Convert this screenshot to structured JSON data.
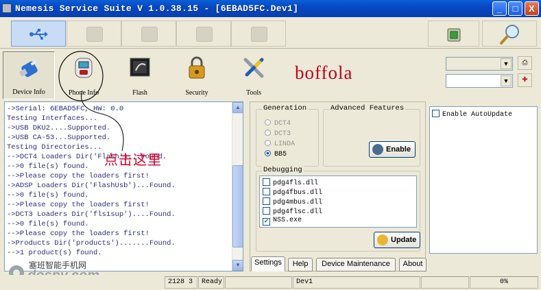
{
  "window": {
    "title": "Nemesis Service Suite V 1.0.38.15 - [6EBAD5FC.Dev1]",
    "buttons": [
      "_",
      "□",
      "X"
    ]
  },
  "top_toolbar": {
    "buttons": [
      "usb-icon",
      "placeholder-icon",
      "placeholder-icon",
      "placeholder-icon",
      "placeholder-icon"
    ],
    "right_buttons": [
      "chip-icon",
      "magnifier-icon"
    ]
  },
  "main_toolbar": {
    "items": [
      {
        "label": "Device Info",
        "icon": "usb-drive-icon"
      },
      {
        "label": "Phone Info",
        "icon": "phone-icon"
      },
      {
        "label": "Flash",
        "icon": "chip-icon"
      },
      {
        "label": "Security",
        "icon": "padlock-icon"
      },
      {
        "label": "Tools",
        "icon": "wrench-screwdriver-icon"
      }
    ],
    "brand": "boffola",
    "combo1_value": "",
    "combo2_value": ""
  },
  "log": {
    "lines": [
      "->Serial: 6EBAD5FC, HW: 0.0",
      "Testing Interfaces...",
      "->USB DKU2....Supported.",
      "->USB CA-53...Supported.",
      "Testing Directories...",
      "-->DCT4 Loaders Dir('Flash')...Found.",
      "-->0 file(s) found.",
      "-->Please copy the loaders first!",
      "->ADSP Loaders Dir('FlashUsb')...Found.",
      "-->0 file(s) found.",
      "-->Please copy the loaders first!",
      "->DCT3 Loaders Dir('fls1sup')....Found.",
      "-->0 file(s) found.",
      "-->Please copy the loaders first!",
      "->Products Dir('products').......Found.",
      "-->1 product(s) found."
    ],
    "annotation": "点击这里"
  },
  "settings": {
    "generation": {
      "title": "Generation",
      "options": [
        "DCT4",
        "DCT3",
        "LINDA",
        "BB5"
      ],
      "selected": "BB5"
    },
    "advanced": {
      "title": "Advanced Features",
      "button": "Enable"
    },
    "debugging": {
      "title": "Debugging",
      "items": [
        {
          "label": "pdg4fls.dll",
          "checked": false
        },
        {
          "label": "pdg4fbus.dll",
          "checked": false
        },
        {
          "label": "pdg4mbus.dll",
          "checked": false
        },
        {
          "label": "pdg4flsc.dll",
          "checked": false
        },
        {
          "label": "NSS.exe",
          "checked": true
        }
      ],
      "button": "Update"
    },
    "tabs": [
      "Settings",
      "Help",
      "Device Maintenance",
      "About"
    ],
    "active_tab": "Settings"
  },
  "autoupdate": {
    "label": "Enable AutoUpdate",
    "checked": false
  },
  "status": {
    "cells": [
      "2128 3",
      "Ready",
      "",
      "Dev1",
      "",
      "0%"
    ]
  },
  "watermark": {
    "cn": "塞班智能手机网",
    "lat": "dospy.com"
  }
}
